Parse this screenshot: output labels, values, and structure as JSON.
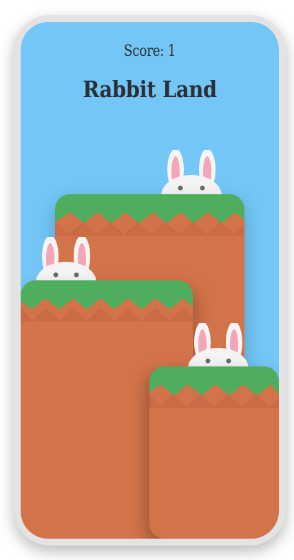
{
  "game": {
    "score_text": "Score: 1",
    "title": "Rabbit Land"
  },
  "colors": {
    "sky": "#73c6f5",
    "dirt": "#d3734a",
    "dirt_dark": "#c96b44",
    "grass": "#4fae5d",
    "rabbit": "#f4f4f4",
    "ear_inner": "#f3a6b5",
    "text": "#2b2f36"
  },
  "pillars": [
    {
      "name": "middle-pillar"
    },
    {
      "name": "left-pillar"
    },
    {
      "name": "right-pillar"
    }
  ],
  "rabbits": [
    {
      "name": "rabbit-top"
    },
    {
      "name": "rabbit-left"
    },
    {
      "name": "rabbit-right"
    }
  ]
}
